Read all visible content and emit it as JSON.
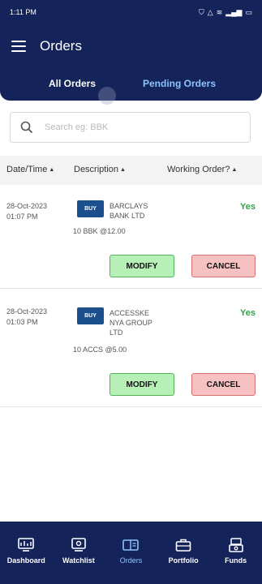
{
  "status_bar": {
    "time": "1:11 PM",
    "icons": [
      "shield-icon",
      "alert-icon",
      "wifi-icon",
      "signal-icon",
      "battery-icon"
    ]
  },
  "header": {
    "title": "Orders",
    "tabs": [
      {
        "label": "All Orders",
        "active": true
      },
      {
        "label": "Pending Orders",
        "active": false
      }
    ]
  },
  "search": {
    "placeholder": "Search eg: BBK"
  },
  "table": {
    "columns": [
      "Date/Time",
      "Description",
      "Working Order?"
    ]
  },
  "orders": [
    {
      "date": "28-Oct-2023",
      "time": "01:07 PM",
      "side": "BUY",
      "name_line1": "BARCLAYS",
      "name_line2": "BANK LTD",
      "name_line3": "",
      "qty": "10 BBK @12.00",
      "working": "Yes",
      "modify_label": "MODIFY",
      "cancel_label": "CANCEL"
    },
    {
      "date": "28-Oct-2023",
      "time": "01:03 PM",
      "side": "BUY",
      "name_line1": "ACCESSKE",
      "name_line2": "NYA GROUP",
      "name_line3": "LTD",
      "qty": "10 ACCS @5.00",
      "working": "Yes",
      "modify_label": "MODIFY",
      "cancel_label": "CANCEL"
    }
  ],
  "bottom_nav": [
    {
      "label": "Dashboard",
      "icon": "dashboard-icon",
      "active": false
    },
    {
      "label": "Watchlist",
      "icon": "watchlist-icon",
      "active": false
    },
    {
      "label": "Orders",
      "icon": "orders-icon",
      "active": true
    },
    {
      "label": "Portfolio",
      "icon": "portfolio-icon",
      "active": false
    },
    {
      "label": "Funds",
      "icon": "funds-icon",
      "active": false
    }
  ],
  "colors": {
    "primary": "#14235a",
    "accent": "#8cc4ff",
    "buy": "#1b4f8e",
    "working_yes": "#34a14a",
    "modify_bg": "#b6f0b6",
    "cancel_bg": "#f7c1c1"
  }
}
